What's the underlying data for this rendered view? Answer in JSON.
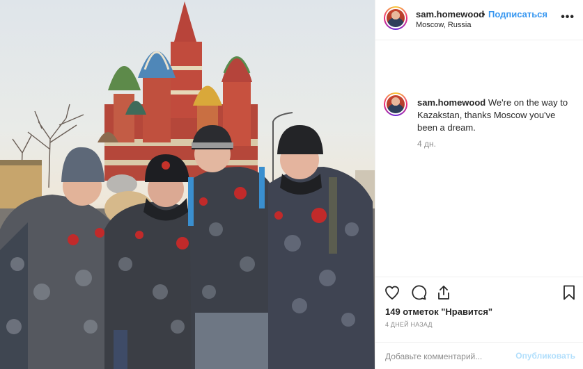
{
  "post": {
    "username": "sam.homewood",
    "separator": "•",
    "follow_label": "Подписаться",
    "location": "Moscow, Russia",
    "more_label": "•••"
  },
  "caption": {
    "username": "sam.homewood",
    "text": "We're on the way to Kazakstan, thanks Moscow you've been a dream.",
    "age": "4 дн."
  },
  "actions": {
    "icons": [
      "heart-icon",
      "comment-icon",
      "share-icon",
      "bookmark-icon"
    ]
  },
  "stats": {
    "likes": "149 отметок \"Нравится\"",
    "date": "4 ДНЕЙ НАЗАД"
  },
  "comment": {
    "placeholder": "Добавьте комментарий...",
    "publish_label": "Опубликовать"
  },
  "colors": {
    "link_blue": "#3897f0",
    "publish_disabled": "#b2dffc",
    "muted": "#8e8e8e"
  }
}
